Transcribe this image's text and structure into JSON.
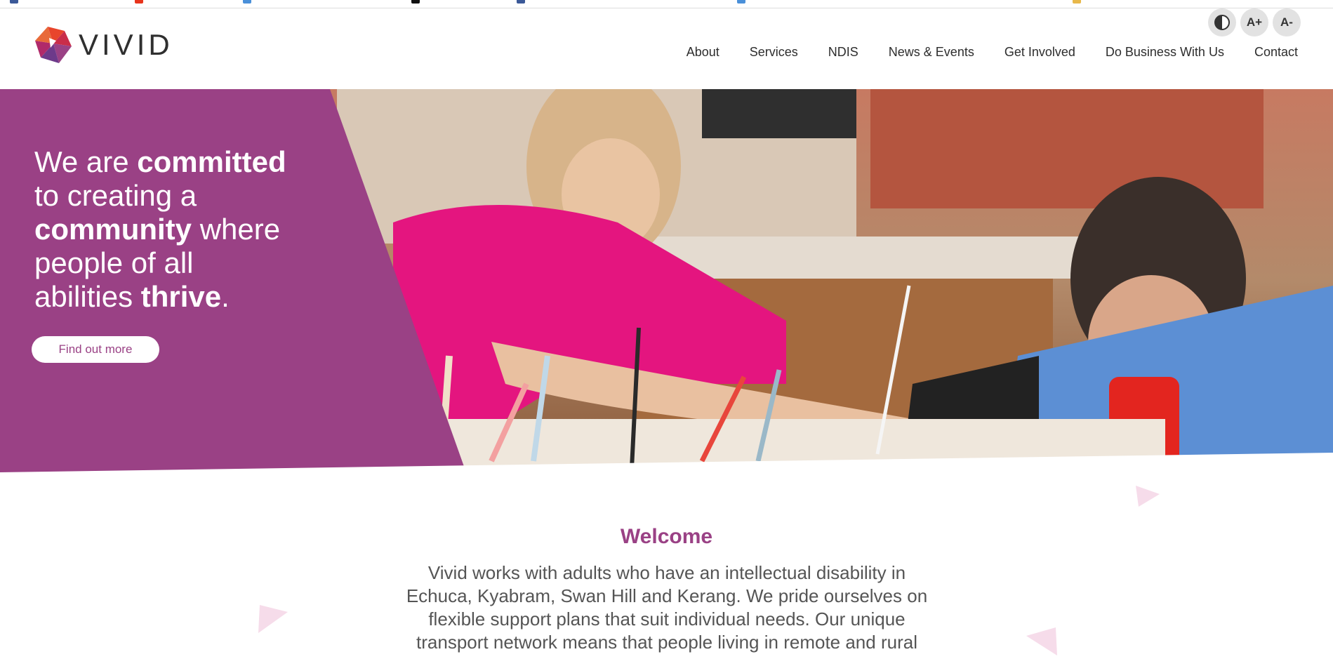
{
  "colors": {
    "brand_purple": "#9a4185",
    "text_dark": "#2d2d2d",
    "pale_triangle": "#f6dcea"
  },
  "logo": {
    "text": "VIVID"
  },
  "accessibility": {
    "contrast_icon": "contrast-icon",
    "increase_label": "A+",
    "decrease_label": "A-"
  },
  "nav": {
    "items": [
      "About",
      "Services",
      "NDIS",
      "News & Events",
      "Get Involved",
      "Do Business With Us",
      "Contact"
    ]
  },
  "hero": {
    "line1_a": "We are ",
    "line1_b": "committed",
    "line2": "to creating a",
    "line3_a": "community",
    "line3_b": " where",
    "line4": "people of all",
    "line5_a": "abilities ",
    "line5_b": "thrive",
    "line5_c": ".",
    "button_label": "Find out more"
  },
  "welcome": {
    "title": "Welcome",
    "body": "Vivid works with adults who have an intellectual disability in Echuca, Kyabram, Swan Hill and Kerang. We pride ourselves on flexible support plans that suit individual needs. Our unique transport network means that people living in remote and rural"
  }
}
